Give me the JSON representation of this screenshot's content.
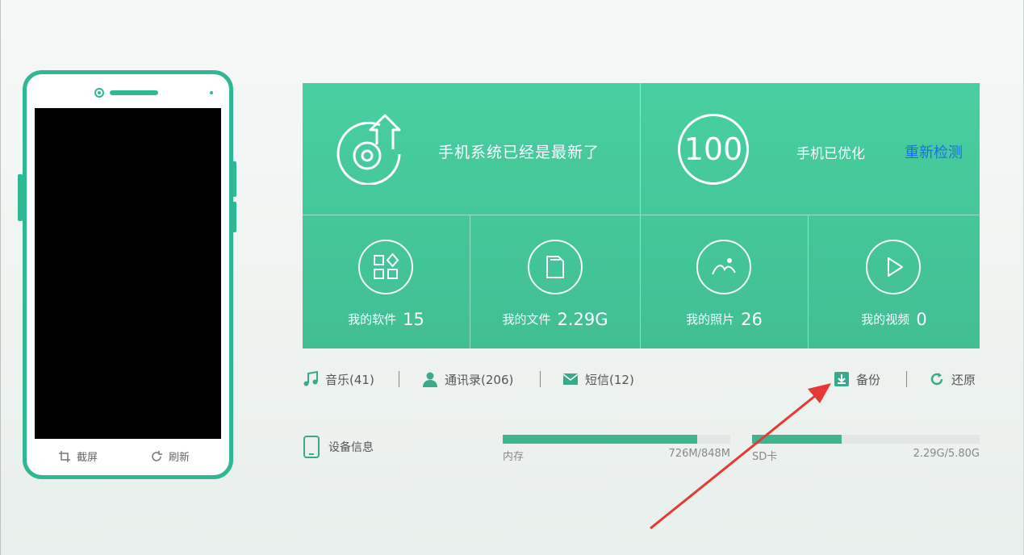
{
  "colors": {
    "accent": "#45c79a",
    "link": "#1a6fe8",
    "annotation": "#e53935"
  },
  "phone": {
    "screenshot_label": "截屏",
    "refresh_label": "刷新"
  },
  "status": {
    "system_text": "手机系统已经是最新了",
    "score": "100",
    "optimized_text": "手机已优化",
    "recheck_label": "重新检测"
  },
  "stats": [
    {
      "icon": "apps-icon",
      "label": "我的软件",
      "value": "15"
    },
    {
      "icon": "files-icon",
      "label": "我的文件",
      "value": "2.29G"
    },
    {
      "icon": "photos-icon",
      "label": "我的照片",
      "value": "26"
    },
    {
      "icon": "video-icon",
      "label": "我的视频",
      "value": "0"
    }
  ],
  "toolbar": {
    "music": "音乐(41)",
    "contacts": "通讯录(206)",
    "sms": "短信(12)",
    "backup": "备份",
    "restore": "还原"
  },
  "device": {
    "title": "设备信息",
    "memory": {
      "label": "内存",
      "value": "726M/848M",
      "fraction": 0.856
    },
    "sd": {
      "label": "SD卡",
      "value": "2.29G/5.80G",
      "fraction": 0.395
    }
  }
}
